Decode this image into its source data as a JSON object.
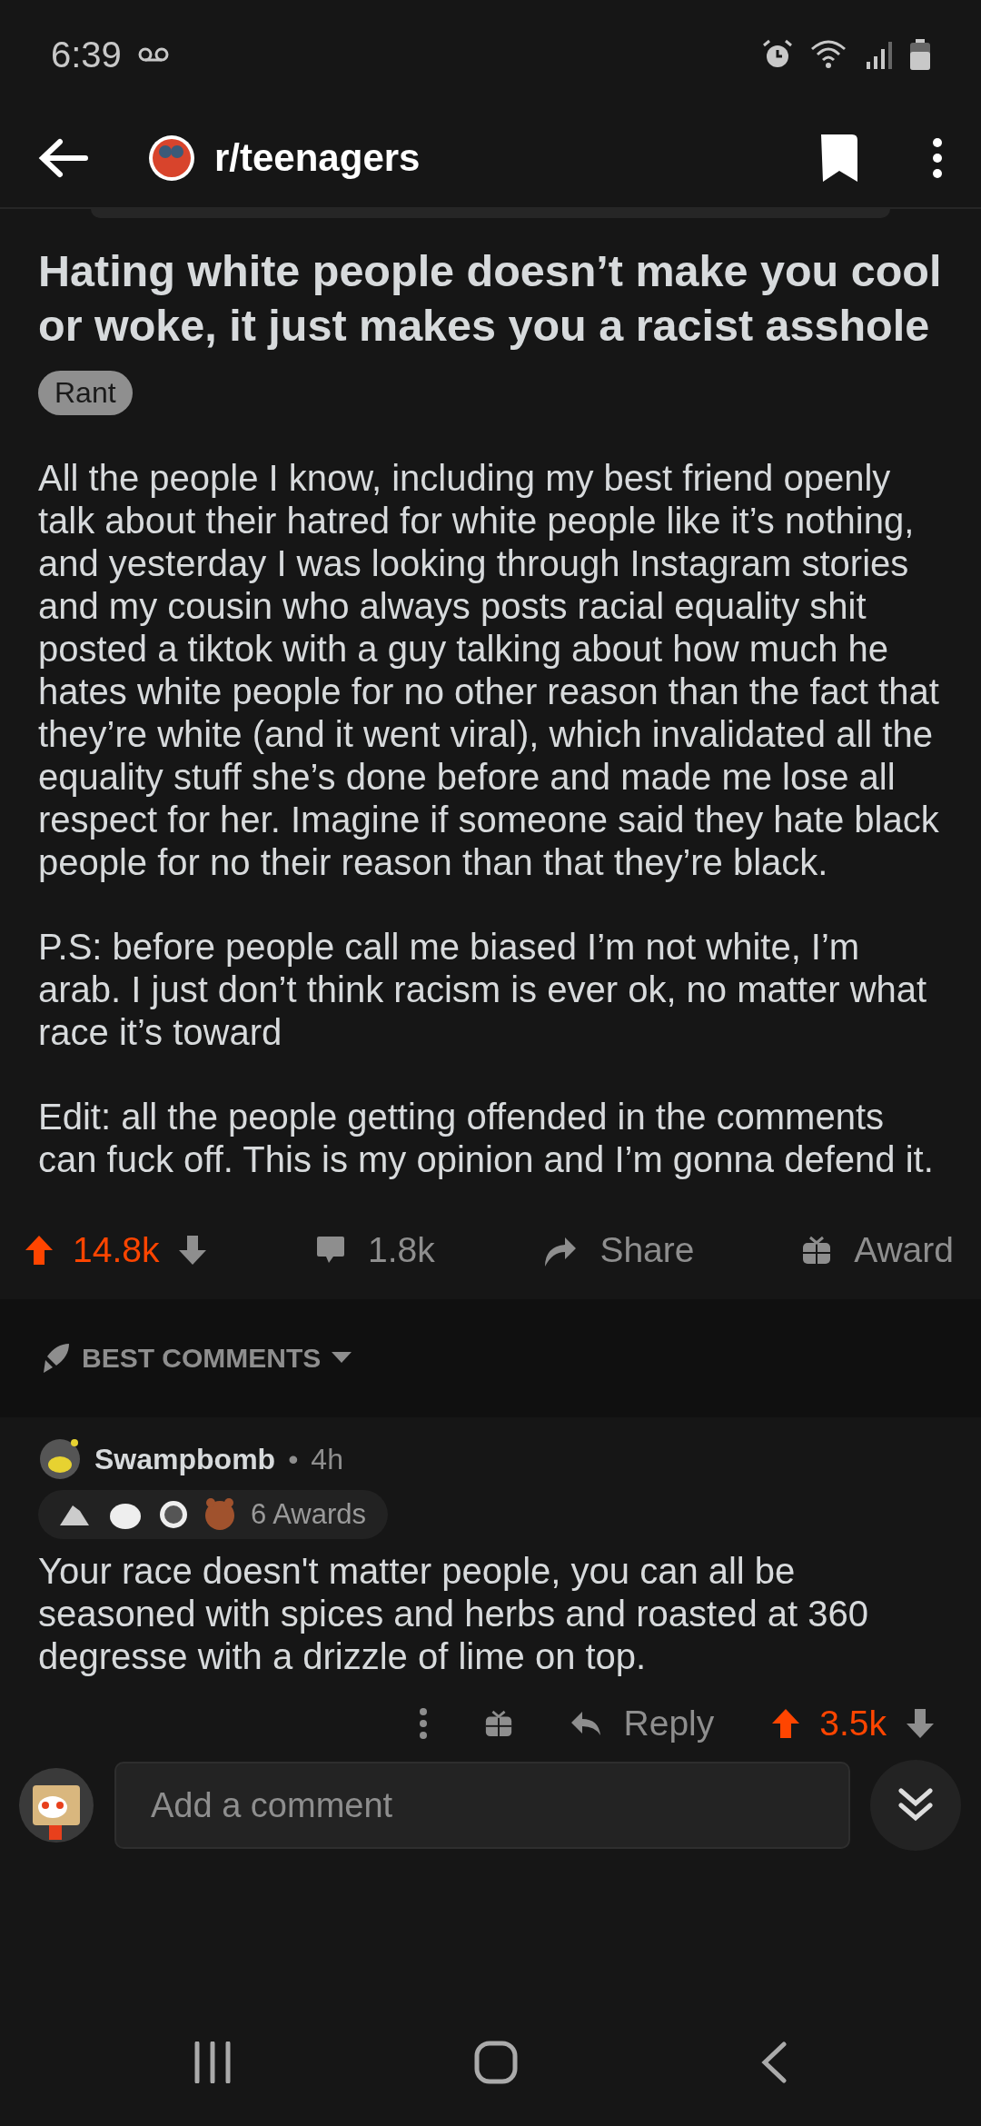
{
  "status_bar": {
    "time": "6:39"
  },
  "toolbar": {
    "subreddit": "r/teenagers"
  },
  "post": {
    "title": "Hating white people doesn’t make you cool or woke, it just makes you a racist asshole",
    "flair": "Rant",
    "paragraphs": [
      "All the people I know, including my best friend openly talk about their hatred for white people like it’s nothing, and yesterday I was looking through Instagram stories and my cousin who always posts racial equality shit posted a tiktok with a guy talking about how much he hates white people for no other reason than the fact that they’re white (and it went viral), which invalidated all the equality stuff she’s  done before and made me lose all respect for her. Imagine if someone said they hate black people for no their reason than that they’re black.",
      "P.S: before people call me biased I’m not white, I’m arab. I just don’t think racism is ever ok, no matter what race it’s toward",
      "Edit: all the people getting offended in the comments can fuck off. This is my opinion and I’m gonna defend it."
    ],
    "score": "14.8k",
    "upvoted": true,
    "comments": "1.8k",
    "share": "Share",
    "award": "Award"
  },
  "sort": {
    "label": "BEST COMMENTS"
  },
  "comments": [
    {
      "author": "Swampbomb",
      "separator": "•",
      "age": "4h",
      "awards": "6 Awards",
      "body": "Your race doesn't matter people, you can all be seasoned with spices and herbs and roasted at 360 degresse with a drizzle of lime on top.",
      "reply": "Reply",
      "score": "3.5k",
      "upvoted": true
    }
  ],
  "composer": {
    "placeholder": "Add a comment"
  }
}
